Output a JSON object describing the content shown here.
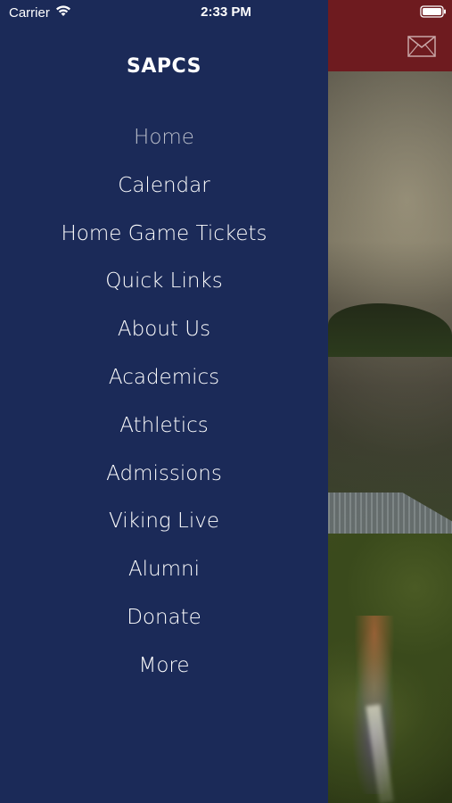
{
  "status_bar": {
    "carrier": "Carrier",
    "time": "2:33 PM"
  },
  "drawer": {
    "title": "SAPCS",
    "items": [
      {
        "label": "Home",
        "active": true
      },
      {
        "label": "Calendar"
      },
      {
        "label": "Home Game Tickets"
      },
      {
        "label": "Quick Links"
      },
      {
        "label": "About Us"
      },
      {
        "label": "Academics"
      },
      {
        "label": "Athletics"
      },
      {
        "label": "Admissions"
      },
      {
        "label": "Viking Live"
      },
      {
        "label": "Alumni"
      },
      {
        "label": "Donate"
      },
      {
        "label": "More"
      }
    ]
  },
  "colors": {
    "drawer_bg": "#1b2a58",
    "header_bg": "#6e1b1f",
    "active_item": "#b9bdc9",
    "text": "#ffffff"
  },
  "icons": {
    "header_right": "mail-icon",
    "status_wifi": "wifi-icon",
    "status_battery": "battery-icon"
  }
}
